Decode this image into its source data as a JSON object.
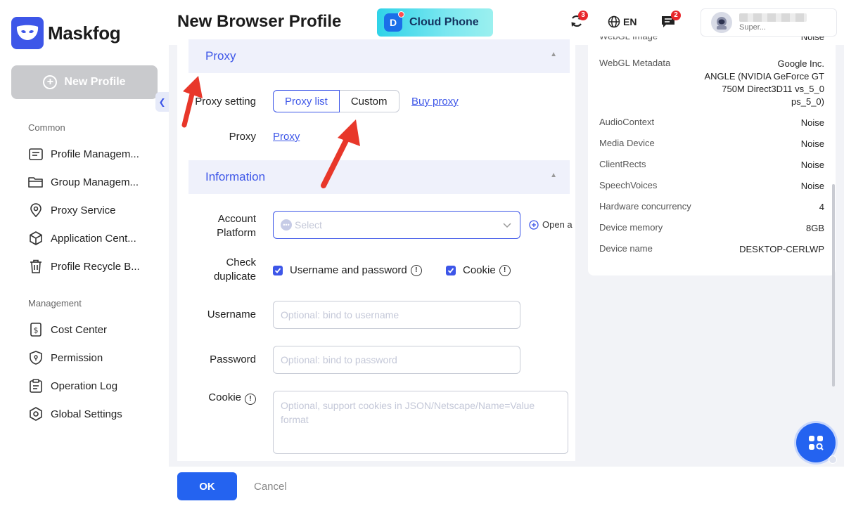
{
  "app": {
    "name": "Maskfog",
    "new_profile_label": "New Profile",
    "collapse_icon": "chevron-left-icon"
  },
  "sidebar": {
    "common_title": "Common",
    "common_items": [
      {
        "label": "Profile Managem...",
        "icon": "profile-list-icon"
      },
      {
        "label": "Group Managem...",
        "icon": "folder-icon"
      },
      {
        "label": "Proxy Service",
        "icon": "location-pin-icon"
      },
      {
        "label": "Application Cent...",
        "icon": "cube-icon"
      },
      {
        "label": "Profile Recycle B...",
        "icon": "trash-icon"
      }
    ],
    "management_title": "Management",
    "management_items": [
      {
        "label": "Cost Center",
        "icon": "dollar-doc-icon"
      },
      {
        "label": "Permission",
        "icon": "shield-icon"
      },
      {
        "label": "Operation Log",
        "icon": "clipboard-icon"
      },
      {
        "label": "Global Settings",
        "icon": "gear-icon"
      }
    ]
  },
  "header": {
    "title": "New Browser Profile",
    "cloud_phone_label": "Cloud Phone",
    "sync_badge": "3",
    "language": "EN",
    "messages_badge": "2",
    "user_role": "Super..."
  },
  "form": {
    "proxy_section_title": "Proxy",
    "proxy_setting_label": "Proxy setting",
    "proxy_list_tab": "Proxy list",
    "custom_tab": "Custom",
    "buy_proxy_link": "Buy proxy",
    "proxy_label": "Proxy",
    "proxy_link": "Proxy",
    "information_section_title": "Information",
    "account_platform_label_1": "Account",
    "account_platform_label_2": "Platform",
    "account_platform_placeholder": "Select",
    "open_link": "Open a",
    "check_duplicate_label_1": "Check",
    "check_duplicate_label_2": "duplicate",
    "check_username_password": "Username and password",
    "check_cookie": "Cookie",
    "username_label": "Username",
    "username_placeholder": "Optional: bind to username",
    "password_label": "Password",
    "password_placeholder": "Optional: bind to password",
    "cookie_label": "Cookie",
    "cookie_placeholder": "Optional, support cookies in JSON/Netscape/Name=Value format"
  },
  "fingerprint": [
    {
      "key": "WebGL Image",
      "value": "Noise"
    },
    {
      "key": "WebGL Metadata",
      "value": "Google Inc. ANGLE (NVIDIA GeForce GT 750M Direct3D11 vs_5_0 ps_5_0)"
    },
    {
      "key": "AudioContext",
      "value": "Noise"
    },
    {
      "key": "Media Device",
      "value": "Noise"
    },
    {
      "key": "ClientRects",
      "value": "Noise"
    },
    {
      "key": "SpeechVoices",
      "value": "Noise"
    },
    {
      "key": "Hardware concurrency",
      "value": "4"
    },
    {
      "key": "Device memory",
      "value": "8GB"
    },
    {
      "key": "Device name",
      "value": "DESKTOP-CERLWP"
    }
  ],
  "webgl_metadata_lines": [
    "Google Inc.",
    "ANGLE (NVIDIA GeForce GT",
    "750M Direct3D11 vs_5_0",
    "ps_5_0)"
  ],
  "footer": {
    "ok_label": "OK",
    "cancel_label": "Cancel"
  },
  "colors": {
    "accent": "#3d56e8",
    "primary_button": "#2463f0",
    "annotation_arrow": "#e8372a"
  }
}
